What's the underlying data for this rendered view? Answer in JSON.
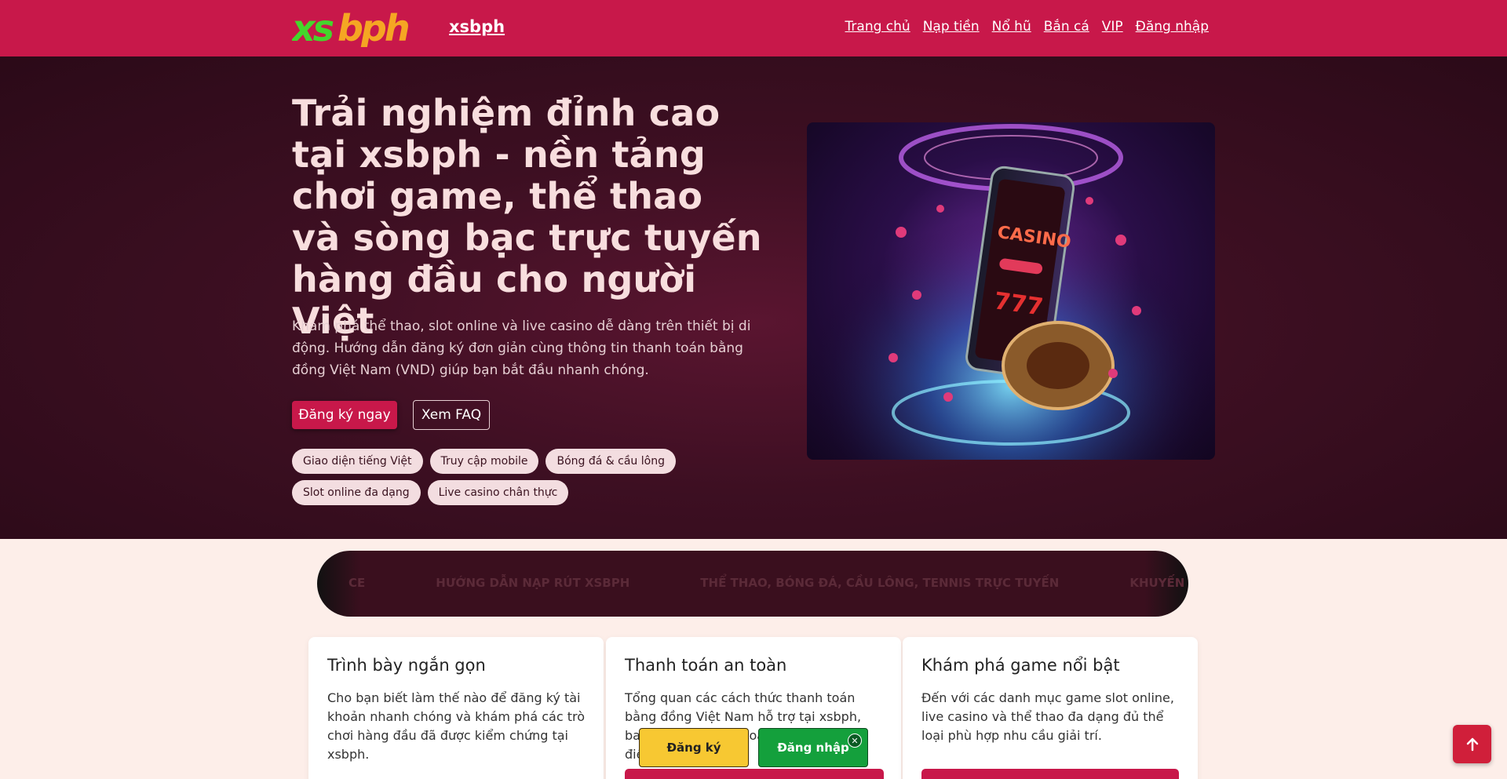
{
  "header": {
    "brand": "xsbph",
    "nav": [
      "Trang chủ",
      "Nạp tiền",
      "Nổ hũ",
      "Bắn cá",
      "VIP",
      "Đăng nhập"
    ]
  },
  "hero": {
    "title": "Trải nghiệm đỉnh cao tại xsbph - nền tảng chơi game, thể thao và sòng bạc trực tuyến hàng đầu cho người Việt",
    "description": "Khám phá thể thao, slot online và live casino dễ dàng trên thiết bị di động. Hướng dẫn đăng ký đơn giản cùng thông tin thanh toán bằng đồng Việt Nam (VND) giúp bạn bắt đầu nhanh chóng.",
    "primary_button": "Đăng ký ngay",
    "secondary_button": "Xem FAQ",
    "chips": [
      "Giao diện tiếng Việt",
      "Truy cập mobile",
      "Bóng đá & cầu lông",
      "Slot online đa dạng",
      "Live casino chân thực"
    ]
  },
  "ticker": [
    "CE",
    "HƯỚNG DẪN NẠP RÚT XSBPH",
    "THỂ THAO, BÓNG ĐÁ, CẦU LÔNG, TENNIS TRỰC TUYẾN",
    "KHUYẾN MÃI THÀNH VIÊN MỚI"
  ],
  "cards": [
    {
      "title": "Trình bày ngắn gọn",
      "text": "Cho bạn biết làm thế nào để đăng ký tài khoản nhanh chóng và khám phá các trò chơi hàng đầu đã được kiểm chứng tại xsbph."
    },
    {
      "title": "Thanh toán an toàn",
      "text": "Tổng quan các cách thức thanh toán bằng đồng Việt Nam hỗ trợ tại xsbph, bao gồm chuyển khoản ngân hàng, ví điện tử và QR."
    },
    {
      "title": "Khám phá game nổi bật",
      "text": "Đến với các danh mục game slot online, live casino và thể thao đa dạng đủ thể loại phù hợp nhu cầu giải trí."
    }
  ],
  "floating": {
    "register": "Đăng ký",
    "login": "Đăng nhập",
    "close": "✕"
  },
  "colors": {
    "header": "#c8184a",
    "hero_bg": "#3d0f22",
    "accent": "#c8184a",
    "register_btn": "#f7c832",
    "login_btn": "#14a03c"
  },
  "icons": {
    "logo": "xsbph-logo",
    "to_top": "arrow-up-icon",
    "close": "close-icon"
  }
}
